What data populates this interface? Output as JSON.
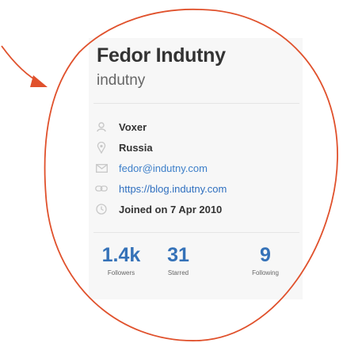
{
  "profile": {
    "fullname": "Fedor Indutny",
    "username": "indutny"
  },
  "details": {
    "organization": "Voxer",
    "location": "Russia",
    "email": "fedor@indutny.com",
    "website": "https://blog.indutny.com",
    "joined": "Joined on 7 Apr 2010"
  },
  "stats": {
    "followers": {
      "value": "1.4k",
      "label": "Followers"
    },
    "starred": {
      "value": "31",
      "label": "Starred"
    },
    "following": {
      "value": "9",
      "label": "Following"
    }
  },
  "icons": {
    "organization": "organization-icon",
    "location": "location-pin-icon",
    "email": "mail-icon",
    "website": "link-icon",
    "joined": "clock-icon"
  },
  "colors": {
    "annotation": "#e0512c",
    "link": "#3572b8",
    "text": "#333333"
  }
}
